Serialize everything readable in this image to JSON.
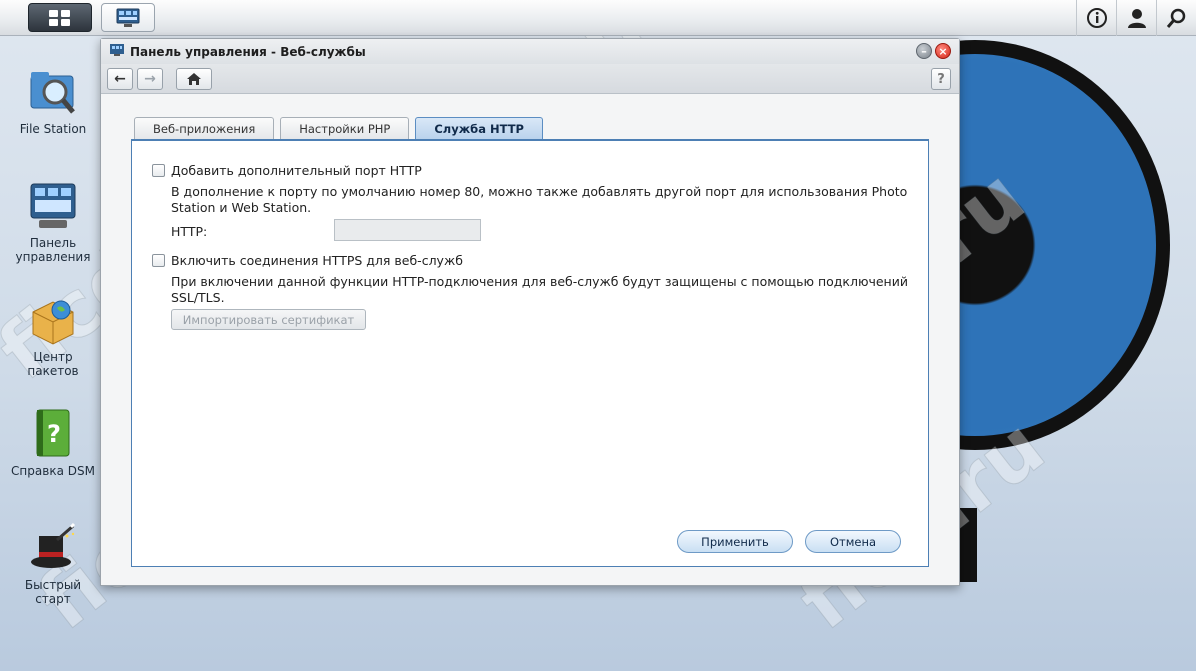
{
  "taskbar": {
    "main_menu_icon": "grid-icon",
    "app_icon": "control-panel-icon",
    "right_icons": [
      "info-icon",
      "user-icon",
      "search-icon"
    ]
  },
  "desktop": {
    "icons": [
      {
        "label": "File Station",
        "icon": "magnifier-folder-icon"
      },
      {
        "label": "Панель управления",
        "icon": "control-panel-icon"
      },
      {
        "label": "Центр пакетов",
        "icon": "package-center-icon"
      },
      {
        "label": "Справка DSM",
        "icon": "help-book-icon"
      },
      {
        "label": "Быстрый старт",
        "icon": "magic-hat-icon"
      }
    ]
  },
  "window": {
    "title": "Панель управления - Веб-службы",
    "toolbar": {
      "back": "←",
      "forward": "→",
      "home": "home-icon",
      "help": "?"
    },
    "tabs": [
      "Веб-приложения",
      "Настройки PHP",
      "Служба HTTP"
    ],
    "active_tab": "Служба HTTP",
    "http": {
      "checkbox_label": "Добавить дополнительный порт HTTP",
      "desc_line1": "В дополнение к порту по умолчанию номер 80, можно также добавлять другой порт для использования Photo",
      "desc_line2": "Station и Web Station.",
      "field_label": "HTTP:",
      "field_value": ""
    },
    "https": {
      "checkbox_label": "Включить соединения HTTPS для веб-служб",
      "desc_line1": "При включении данной функции HTTP-подключения для веб-служб будут защищены с помощью подключений",
      "desc_line2": "SSL/TLS.",
      "import_button": "Импортировать сертификат"
    },
    "apply_button": "Применить",
    "cancel_button": "Отмена"
  },
  "watermark": "ficd.ru",
  "colors": {
    "accent": "#4d7fb4",
    "close": "#d32414",
    "disc_blue": "#2e73b8"
  }
}
